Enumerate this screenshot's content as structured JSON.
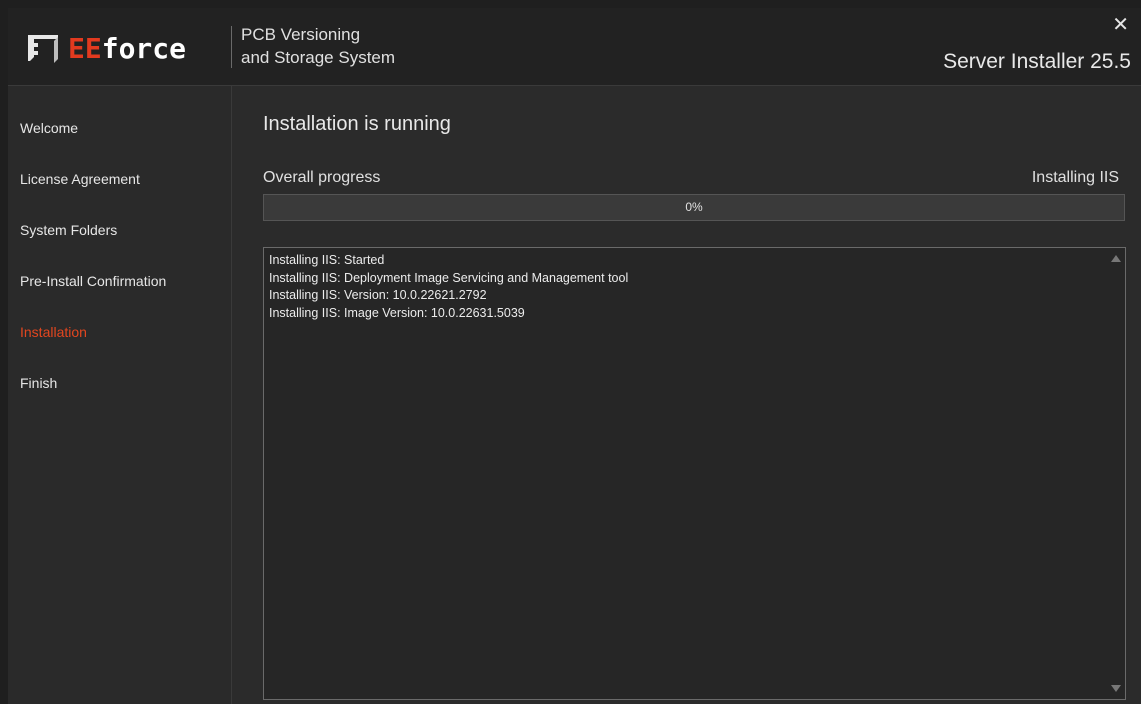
{
  "header": {
    "logo_text_prefix": "EE",
    "logo_text_suffix": "force",
    "logo_icon": "eeforce-logo-icon",
    "subtitle_line1": "PCB Versioning",
    "subtitle_line2": "and Storage System",
    "close_label": "✕",
    "installer_title": "Server Installer 25.5"
  },
  "sidebar": {
    "steps": [
      {
        "label": "Welcome"
      },
      {
        "label": "License Agreement"
      },
      {
        "label": "System Folders"
      },
      {
        "label": "Pre-Install Confirmation"
      },
      {
        "label": "Installation",
        "active": true
      },
      {
        "label": "Finish"
      }
    ]
  },
  "main": {
    "title": "Installation is running",
    "progress": {
      "label": "Overall progress",
      "status": "Installing IIS",
      "percent_text": "0%",
      "value": 0
    },
    "log": [
      "Installing IIS: Started",
      "Installing IIS: Deployment Image Servicing and Management tool",
      "Installing IIS: Version: 10.0.22621.2792",
      "Installing IIS: Image Version: 10.0.22631.5039"
    ]
  },
  "colors": {
    "accent": "#e2461f",
    "background": "#2b2b2b",
    "header_background": "#222222"
  }
}
